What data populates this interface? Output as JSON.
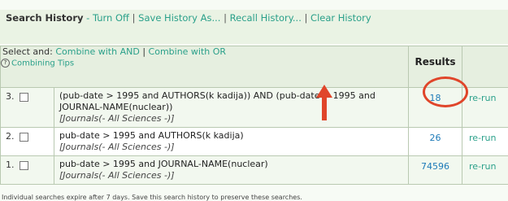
{
  "header": {
    "title": "Search History",
    "dash": " - ",
    "links": [
      "Turn Off",
      "Save History As...",
      "Recall History...",
      "Clear History"
    ],
    "separator": "|"
  },
  "table": {
    "select_and": "Select and:",
    "combine_and": "Combine with AND",
    "combine_sep": "|",
    "combine_or": "Combine with OR",
    "combining_tips": "Combining Tips",
    "results_header": "Results",
    "rows": [
      {
        "number": "3.",
        "query": "(pub-date > 1995 and AUTHORS(k kadija)) AND (pub-date > 1995 and JOURNAL-NAME(nuclear))",
        "source": "[Journals(- All Sciences -)]",
        "results": "18",
        "action": "re-run"
      },
      {
        "number": "2.",
        "query": "pub-date > 1995 and AUTHORS(k kadija)",
        "source": "[Journals(- All Sciences -)]",
        "results": "26",
        "action": "re-run"
      },
      {
        "number": "1.",
        "query": "pub-date > 1995 and JOURNAL-NAME(nuclear)",
        "source": "[Journals(- All Sciences -)]",
        "results": "74596",
        "action": "re-run"
      }
    ]
  },
  "footer": "Individual searches expire after 7 days. Save this search history to preserve these searches.",
  "colors": {
    "link": "#2aa08a",
    "result_link": "#1d7ab8",
    "annotation": "#e0452a"
  },
  "icons": [
    "help-icon",
    "checkbox-icon",
    "annotation-arrow-icon",
    "annotation-circle"
  ]
}
